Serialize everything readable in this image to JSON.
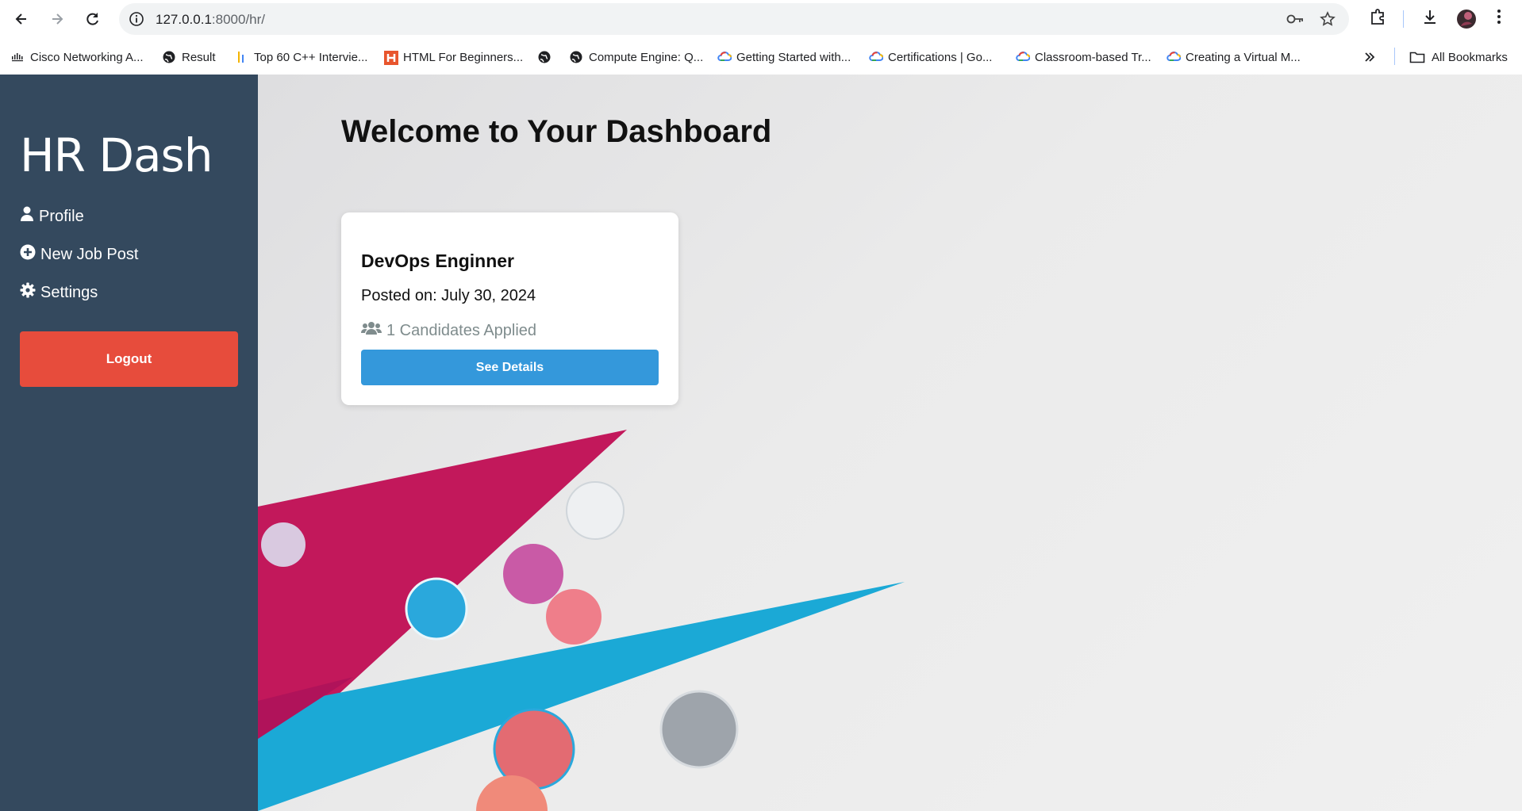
{
  "browser": {
    "url_host": "127.0.0.1",
    "url_path": ":8000/hr/",
    "icons": [
      "back-icon",
      "forward-icon",
      "reload-icon",
      "site-info-icon",
      "key-icon",
      "star-icon",
      "extensions-icon",
      "download-icon",
      "profile-avatar",
      "menu-icon"
    ]
  },
  "bookmarks": {
    "items": [
      {
        "label": "Cisco Networking A...",
        "icon": "cisco-icon"
      },
      {
        "label": "Result",
        "icon": "globe-icon"
      },
      {
        "label": "Top 60 C++ Intervie...",
        "icon": "bars-icon"
      },
      {
        "label": "HTML For Beginners...",
        "icon": "h-icon"
      },
      {
        "label": "",
        "icon": "globe-icon"
      },
      {
        "label": "Compute Engine: Q...",
        "icon": "globe-icon"
      },
      {
        "label": "Getting Started with...",
        "icon": "gcloud-icon"
      },
      {
        "label": "Certifications | Go...",
        "icon": "gcloud-icon"
      },
      {
        "label": "Classroom-based Tr...",
        "icon": "gcloud-icon"
      },
      {
        "label": "Creating a Virtual M...",
        "icon": "gcloud-icon"
      }
    ],
    "overflow_icon": "chevrons-right-icon",
    "all_bookmarks": "All Bookmarks"
  },
  "sidebar": {
    "brand": "HR Dash",
    "links": [
      {
        "label": "Profile",
        "icon": "user-icon"
      },
      {
        "label": "New Job Post",
        "icon": "plus-circle-icon"
      },
      {
        "label": "Settings",
        "icon": "gear-icon"
      }
    ],
    "logout": "Logout"
  },
  "main": {
    "title": "Welcome to Your Dashboard",
    "jobs": [
      {
        "title": "DevOps Enginner",
        "posted": "Posted on: July 30, 2024",
        "applied": "1 Candidates Applied",
        "button": "See Details"
      }
    ]
  },
  "colors": {
    "sidebar": "#34495e",
    "logout": "#e74c3c",
    "primary": "#3498db",
    "muted": "#7f8c8d"
  }
}
